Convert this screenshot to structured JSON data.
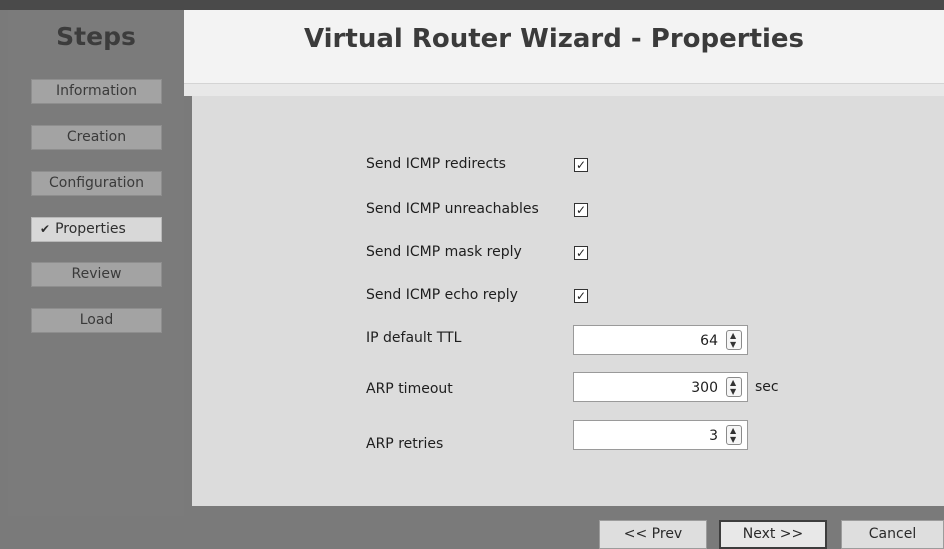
{
  "sidebar": {
    "title": "Steps",
    "steps": [
      {
        "label": "Information",
        "check": ""
      },
      {
        "label": "Creation",
        "check": ""
      },
      {
        "label": "Configuration",
        "check": ""
      },
      {
        "label": "Properties",
        "check": "✔"
      },
      {
        "label": "Review",
        "check": ""
      },
      {
        "label": "Load",
        "check": ""
      }
    ]
  },
  "header": {
    "title": "Virtual Router Wizard - Properties"
  },
  "form": {
    "send_icmp_redirects": {
      "label": "Send ICMP redirects",
      "checked": true,
      "mark": "✓"
    },
    "send_icmp_unreachables": {
      "label": "Send ICMP unreachables",
      "checked": true,
      "mark": "✓"
    },
    "send_icmp_mask_reply": {
      "label": "Send ICMP mask reply",
      "checked": true,
      "mark": "✓"
    },
    "send_icmp_echo_reply": {
      "label": "Send ICMP echo reply",
      "checked": true,
      "mark": "✓"
    },
    "ip_default_ttl": {
      "label": "IP default TTL",
      "value": "64"
    },
    "arp_timeout": {
      "label": "ARP timeout",
      "value": "300",
      "unit": "sec"
    },
    "arp_retries": {
      "label": "ARP retries",
      "value": "3"
    }
  },
  "footer": {
    "prev_label": "<< Prev",
    "next_label": "Next >>",
    "cancel_label": "Cancel"
  },
  "colors": {
    "background": "#7a7a7a",
    "header_bg": "#f3f3f3",
    "content_bg": "#dcdcdc",
    "active_step_bg": "#d8d8d8"
  },
  "icons": {
    "check": "checkmark-icon",
    "spin_up": "chevron-up-icon",
    "spin_down": "chevron-down-icon"
  }
}
